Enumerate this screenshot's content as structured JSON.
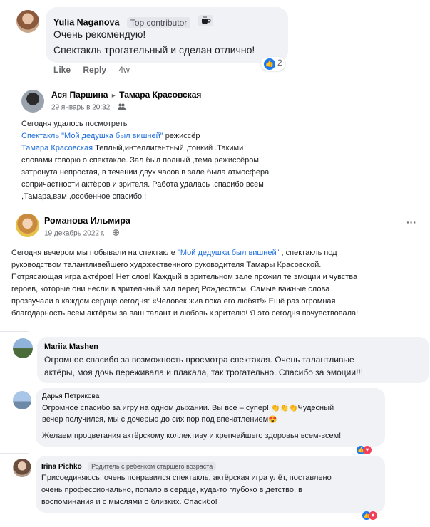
{
  "c1": {
    "author": "Yulia Naganova",
    "badge": "Top contributor",
    "badge_icon": "coffee-cup-icon",
    "lines": [
      "Очень рекомендую!",
      "Спектакль трогательный и сделан отлично!"
    ],
    "like": "Like",
    "reply": "Reply",
    "time": "4w",
    "reactions": "2"
  },
  "p1": {
    "author": "Ася Паршина",
    "arrow": "▸",
    "target": "Тамара Красовская",
    "date": "29 январь в 20:32 ·",
    "privacy_icon": "friends-icon",
    "l1": "Сегодня удалось посмотреть",
    "link1": "Спектакль \"Мой дедушка был вишней\"",
    "l2b": " режиссёр",
    "link2": "Тамара Красовская",
    "l3b": "  Теплый,интеллигентный ,тонкий .Такими",
    "l4": "словами  говорю о спектакле. Зал был полный ,тема режиссёром",
    "l5": "затронута непростая, в течении двух часов в зале была атмосфера",
    "l6": "сопричастности актёров и зрителя. Работа удалась ,спасибо всем",
    "l7": ",Тамара,вам ,особенное спасибо !"
  },
  "p2": {
    "author": "Романова Ильмира",
    "date": "19 декабрь 2022 г. ·",
    "privacy_icon": "globe-icon",
    "more": "···",
    "l1a": "Сегодня вечером мы побывали на спектакле ",
    "l1link": "\"Мой дедушка был вишней\"",
    "l1b": " , спектакль под",
    "l2": "руководством талантливейшего художественного руководителя Тамары Красовской.",
    "l3": "Потрясающая игра актёров! Нет слов! Каждый в зрительном зале прожил те эмоции и чувства",
    "l4": "героев, которые они несли в зрительный зал перед Рождеством! Самые важные слова",
    "l5": "прозвучали в каждом сердце сегодня: «Человек жив пока его любят!» Ещё раз огромная",
    "l6": "благодарность всем актёрам за ваш талант и любовь к зрителю! Я это сегодня почувствовала!"
  },
  "c2": {
    "author": "Mariia Mashen",
    "l1": "Огромное спасибо за возможность просмотра спектакля. Очень талантливые",
    "l2": "актёры, моя дочь переживала и плакала, так трогательно. Спасибо за эмоции!!!"
  },
  "c3": {
    "author": "Дарья Петрикова",
    "l1": "Огромное спасибо за игру на одном дыхании. Вы все – супер! ",
    "clap": "👏👏👏",
    "l1b": "Чудесный",
    "l2": "вечер получился, мы с дочерью до сих пор под впечатлением",
    "heart_eyes": "😍",
    "l3": "Желаем процветания актёрскому коллективу и крепчайшего здоровья всем-всем!"
  },
  "c4": {
    "author": "Irina Pichko",
    "badge": "Родитель с ребенком старшего возраста",
    "l1": "Присоединяюсь, очень понравился спектакль, актёрская игра улёт, поставлено",
    "l2": "очень профессионально, попало в сердце, куда-то глубоко в детство, в",
    "l3": "воспоминания и с мыслями о близких. Спасибо!"
  },
  "colors": {
    "link": "#216fdb",
    "bubble": "#f0f2f5",
    "muted": "#65676b",
    "like_blue": "#1877f2",
    "love_red": "#f33e58"
  }
}
